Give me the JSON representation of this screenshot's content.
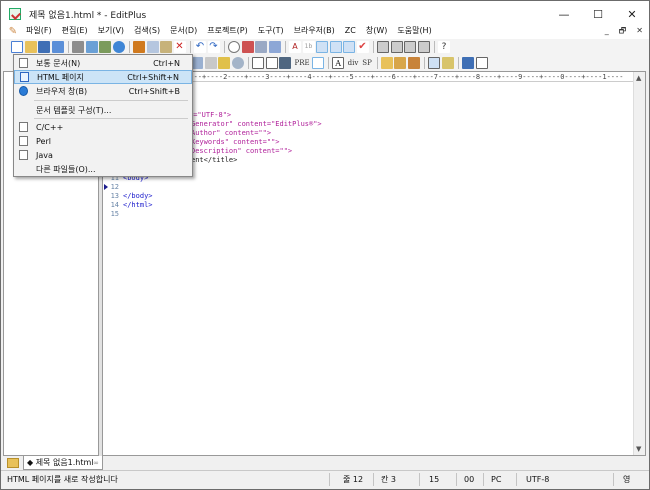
{
  "window": {
    "title": "제목 없음1.html * - EditPlus",
    "minimize": "—",
    "maximize": "☐",
    "close": "✕"
  },
  "menubar": {
    "items": [
      "파일(F)",
      "편집(E)",
      "보기(V)",
      "검색(S)",
      "문서(D)",
      "프로젝트(P)",
      "도구(T)",
      "브라우저(B)",
      "ZC",
      "창(W)",
      "도움말(H)"
    ],
    "right_controls": [
      "_",
      "🗗",
      "✕"
    ]
  },
  "toolbar2": {
    "div_label": "div",
    "sp_label": "SP",
    "pre_label": "PRE"
  },
  "dropdown": {
    "items": [
      {
        "label": "보통 문서(N)",
        "shortcut": "Ctrl+N"
      },
      {
        "label": "HTML 페이지",
        "shortcut": "Ctrl+Shift+N"
      },
      {
        "label": "브라우저 창(B)",
        "shortcut": "Ctrl+Shift+B"
      },
      {
        "label": "문서 템플릿 구성(T)...",
        "shortcut": ""
      },
      {
        "label": "C/C++",
        "shortcut": ""
      },
      {
        "label": "Perl",
        "shortcut": ""
      },
      {
        "label": "Java",
        "shortcut": ""
      },
      {
        "label": "다른 파일들(O)...",
        "shortcut": ""
      }
    ]
  },
  "editor": {
    "ruler": "----+----1----+----2----+----3----+----4----+----5----+----6----+----7----+----8----+----9----+----0----+----1----"
  },
  "code": {
    "l1": ">",
    "l2": "\">",
    "l3_a": "t=\"UTF-8\">",
    "l4_a": "Generator\" content=\"EditPlus®\">",
    "l5_a": "Author\" content=\"\">",
    "l6_a": "Keywords\" content=\"\">",
    "l7_a": "Description\" content=\"\">",
    "l8_a": "ent</title>",
    "l11_n": "11",
    "l11": "<body>",
    "l12_n": "12",
    "l13_n": "13",
    "l13": "</body>",
    "l14_n": "14",
    "l14": "</html>",
    "l15_n": "15"
  },
  "tabbar": {
    "tab_label": "◆ 제목 없음1.html",
    "tab_close": "∞"
  },
  "statusbar": {
    "message": "HTML 페이지를 새로 작성합니다",
    "line": "줄 12",
    "col": "칸 3",
    "chars": "15",
    "val2": "00",
    "mode": "PC",
    "encoding": "UTF-8",
    "ime": "영"
  },
  "colors": {
    "highlight": "#cce4f7",
    "tag": "#1a1acc",
    "attr": "#b0209a"
  }
}
